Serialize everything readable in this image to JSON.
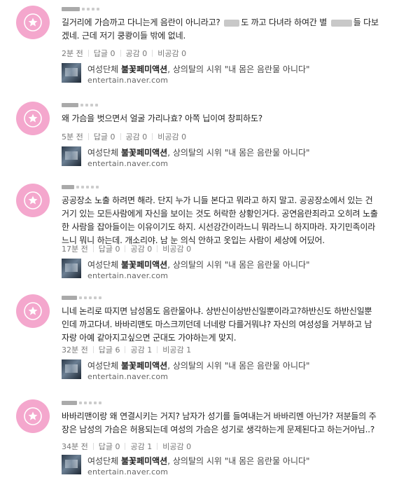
{
  "news": {
    "title_prefix": "여성단체 ",
    "title_bold": "불꽃페미액션",
    "title_suffix": ", 상의탈의 시위 \"내 몸은 음란물 아니다\"",
    "domain": "entertain.naver.com"
  },
  "comments": [
    {
      "lines": [
        "길거리에 가슴까고 다니는게 음란이 아니라고?",
        "도 까고 다녀라 하여간 별",
        "들 다보",
        "겠네. 근데 저기 쿵쾅이들 밖에 없네."
      ],
      "time": "2분 전",
      "reply": "답글 0",
      "like": "공감 0",
      "dislike": "비공감 0"
    },
    {
      "lines": [
        "왜 가슴을 벗으면서 얼굴 가리나효? 아쪽 닙이여 창피하도?"
      ],
      "time": "5분 전",
      "reply": "답글 0",
      "like": "공감 0",
      "dislike": "비공감 0"
    },
    {
      "lines": [
        "공공장소 노출 하려면 해라. 단지 누가 니들 본다고 뭐라고 하지 말고. 공공장소에서 있는 건",
        "거기 있는 모든사람에게 자신을 보이는 것도 허락한 상황인거다. 공연음란죄라고 오히려 노출",
        "한 사람을 잡아들이는 이유이기도 하지. 시선강간이라느니 뭐라느니 하지마라. 자기민족이라",
        "느니 뭐니 하는데. 개소리야. 남 눈 의식 안하고 옷입는 사람이 세상에 어딨어."
      ],
      "time": "17분 전",
      "reply": "답글 0",
      "like": "공감 0",
      "dislike": "비공감 0"
    },
    {
      "lines": [
        "니네 논리로 따지면 남성몸도 음란물아냐. 상반신이상반신일뿐이라고?하반신도 하반신일뿐",
        "인데 까고다녀. 바바리맨도 마스크끼던데 너네랑 다를거뭐냐? 자신의 여성성을 거부하고 남",
        "자랑 아예 같아지고싶으면 군대도 가야하는게 맞지."
      ],
      "time": "32분 전",
      "reply": "답글 6",
      "like": "공감 1",
      "dislike": "비공감 1"
    },
    {
      "lines": [
        "바바리맨이랑 왜 연결시키는 거지? 남자가 성기를 들여내는거 바바리멘 아닌가? 저분들의 주",
        "장은 남성의 가슴은 허용되는데 여성의 가슴은 성기로 생각하는게 문제된다고 하는거아님..?"
      ],
      "time": "34분 전",
      "reply": "답글 0",
      "like": "공감 1",
      "dislike": "비공감 0"
    }
  ]
}
